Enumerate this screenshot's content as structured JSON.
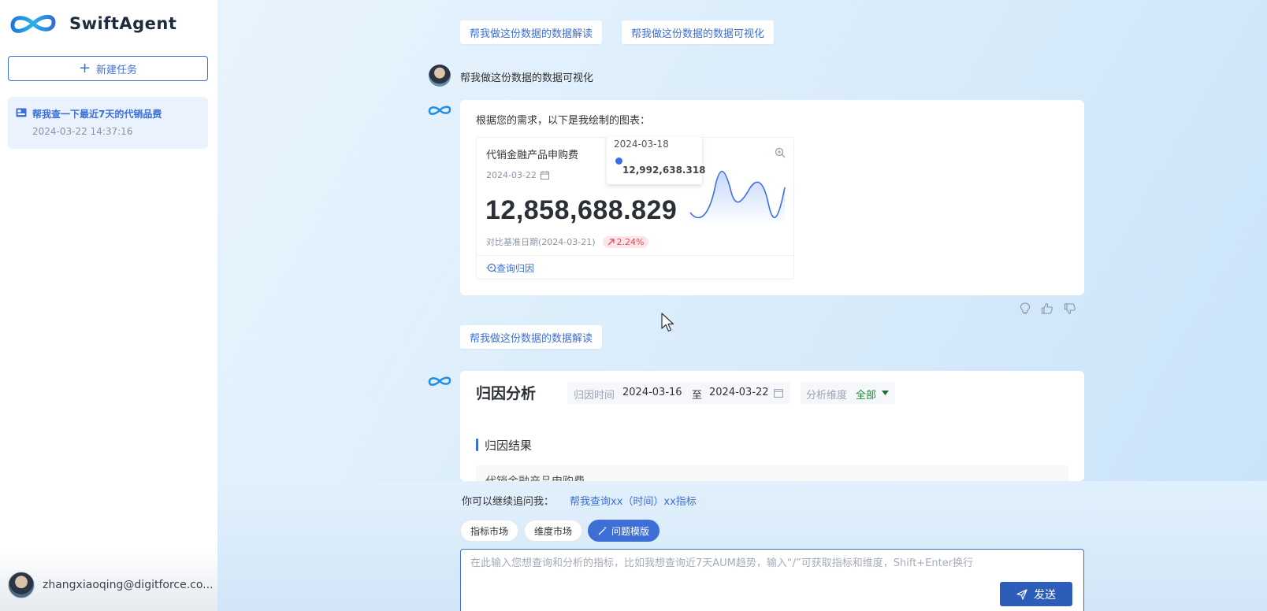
{
  "app": {
    "brand": "SwiftAgent",
    "accent_color": "#3d6fd6"
  },
  "sidebar": {
    "new_task_label": "新建任务",
    "history": [
      {
        "title": "帮我查一下最近7天的代销品费",
        "time": "2024-03-22 14:37:16",
        "icon": "chart-icon"
      }
    ],
    "user_email": "zhangxiaoqing@digitforce.co..."
  },
  "chat": {
    "top_suggestions": [
      "帮我做这份数据的数据解读",
      "帮我做这份数据的数据可视化"
    ],
    "user_message": "帮我做这份数据的数据可视化",
    "bot_intro": "根据您的需求，以下是我绘制的图表：",
    "metric_card": {
      "title": "代销金融产品申购费",
      "date": "2024-03-22",
      "value": "12,858,688.829",
      "compare_label": "对比基准日期(2024-03-21)",
      "change": "2.24%",
      "change_direction": "up",
      "link_label": "查询归因",
      "tooltip": {
        "date": "2024-03-18",
        "value": "12,992,638.318"
      }
    },
    "middle_suggestion": "帮我做这份数据的数据解读",
    "attribution": {
      "title": "归因分析",
      "time_label": "归因时间",
      "start_date": "2024-03-16",
      "to_label": "至",
      "end_date": "2024-03-22",
      "dimension_label": "分析维度",
      "dimension_value": "全部",
      "section_title": "归因结果",
      "section_content": "代销金融产品申购费"
    }
  },
  "bottom": {
    "followup_label": "你可以继续追问我：",
    "followup_link": "帮我查询xx（时间）xx指标",
    "pills": [
      "指标市场",
      "维度市场",
      "问题模版"
    ],
    "input_placeholder": "在此输入您想查询和分析的指标，比如我想查询近7天AUM趋势，输入“/”可获取指标和维度，Shift+Enter换行",
    "send_label": "发送"
  }
}
